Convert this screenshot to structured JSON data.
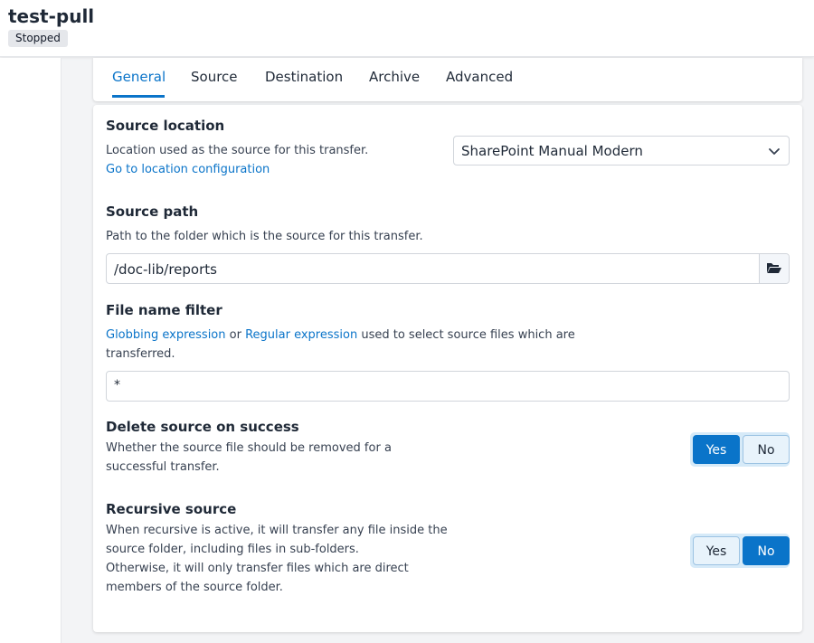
{
  "header": {
    "title": "test-pull",
    "status": "Stopped"
  },
  "tabs": [
    {
      "label": "General",
      "active": true
    },
    {
      "label": "Source",
      "active": false
    },
    {
      "label": "Destination",
      "active": false
    },
    {
      "label": "Archive",
      "active": false
    },
    {
      "label": "Advanced",
      "active": false
    }
  ],
  "source_location": {
    "title": "Source location",
    "description": "Location used as the source for this transfer.",
    "link": "Go to location configuration",
    "selected": "SharePoint Manual Modern"
  },
  "source_path": {
    "title": "Source path",
    "description": "Path to the folder which is the source for this transfer.",
    "value": "/doc-lib/reports",
    "icon": "folder-open-icon"
  },
  "file_filter": {
    "title": "File name filter",
    "link_globbing": "Globbing expression",
    "text_or": " or ",
    "link_regex": "Regular expression",
    "text_rest_1": " used to select source files which are",
    "text_rest_2": "transferred.",
    "value": "*"
  },
  "delete_source": {
    "title": "Delete source on success",
    "line1": "Whether the source file should be removed for a",
    "line2": "successful transfer.",
    "yes": "Yes",
    "no": "No",
    "selected": "Yes"
  },
  "recursive_source": {
    "title": "Recursive source",
    "line1": "When recursive is active, it will transfer any file inside the",
    "line2": "source folder, including files in sub-folders.",
    "line3": "Otherwise, it will only transfer files which are direct",
    "line4": "members of the source folder.",
    "yes": "Yes",
    "no": "No",
    "selected": "No"
  },
  "colors": {
    "accent": "#0a74c9",
    "toggle_bg": "#d6eaf8"
  }
}
